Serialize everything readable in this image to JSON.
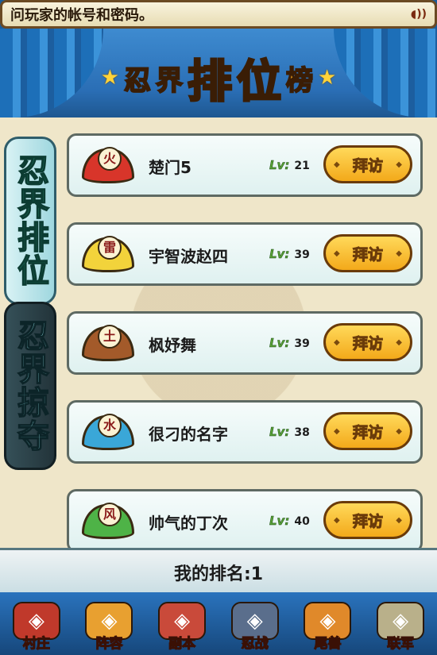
{
  "ticker": {
    "text": "问玩家的帐号和密码。",
    "speaker_icon": "speaker-icon"
  },
  "title": {
    "part1": "忍",
    "part2": "界",
    "part3": "排",
    "part4": "位",
    "part5": "榜"
  },
  "side_tabs": {
    "active": "忍界排位",
    "inactive": "忍界掠夺"
  },
  "players": [
    {
      "element": "火",
      "name": "楚门5",
      "level": "21",
      "color": "#d8352a"
    },
    {
      "element": "雷",
      "name": "宇智波赵四",
      "level": "39",
      "color": "#f2d33b"
    },
    {
      "element": "土",
      "name": "枫妤舞",
      "level": "39",
      "color": "#a35a2a"
    },
    {
      "element": "水",
      "name": "很刁的名字",
      "level": "38",
      "color": "#3aa7d8"
    },
    {
      "element": "风",
      "name": "帅气的丁次",
      "level": "40",
      "color": "#4eb347"
    }
  ],
  "lv_label": "Lv:",
  "visit_label": "拜访",
  "my_rank": "我的排名:1",
  "nav": [
    {
      "label": "村庄",
      "icon": "village-icon",
      "color": "#c0392b"
    },
    {
      "label": "阵容",
      "icon": "ninja-face-icon",
      "color": "#e8a030"
    },
    {
      "label": "副本",
      "icon": "scroll-icon",
      "color": "#c94a3a"
    },
    {
      "label": "忍战",
      "icon": "shuriken-icon",
      "color": "#5a6e8c"
    },
    {
      "label": "尾兽",
      "icon": "fox-icon",
      "color": "#e0892a"
    },
    {
      "label": "联军",
      "icon": "headband-icon",
      "color": "#b9b08a"
    }
  ]
}
